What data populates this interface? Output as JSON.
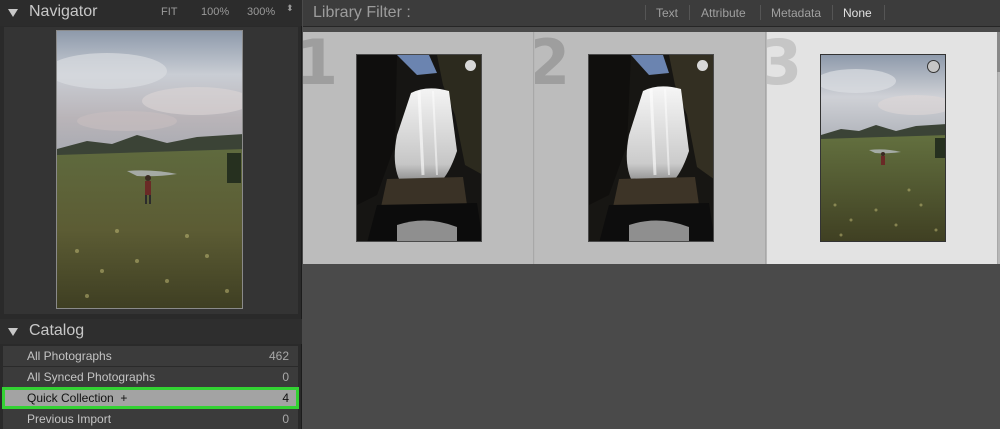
{
  "navigator": {
    "title": "Navigator",
    "zoom_fit": "FIT",
    "zoom_100": "100%",
    "zoom_300": "300%",
    "zoom_menu_glyph": "⬍"
  },
  "catalog": {
    "title": "Catalog",
    "items": [
      {
        "label": "All Photographs",
        "count": "462"
      },
      {
        "label": "All Synced Photographs",
        "count": "0"
      },
      {
        "label": "Quick Collection  +",
        "count": "4"
      },
      {
        "label": "Previous Import",
        "count": "0"
      }
    ]
  },
  "filter": {
    "title": "Library Filter :",
    "tabs": [
      "Text",
      "Attribute",
      "Metadata",
      "None"
    ],
    "active_tab": "None"
  },
  "grid": {
    "cells": [
      {
        "number": "1",
        "subject": "waterfall"
      },
      {
        "number": "2",
        "subject": "waterfall"
      },
      {
        "number": "3",
        "subject": "meadow"
      }
    ],
    "selected_cell": "3"
  },
  "colors": {
    "selection_outline": "#33d233",
    "panel_bg": "#2a2a2a",
    "grid_bg": "#bcbcbc",
    "grid_active_bg": "#e3e3e3"
  }
}
